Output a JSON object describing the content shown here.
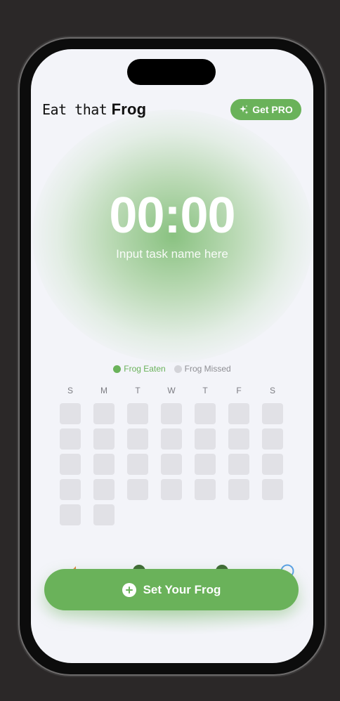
{
  "app": {
    "title_part1": "Eat that",
    "title_part2": "Frog"
  },
  "header": {
    "pro_label": "Get PRO",
    "pro_icon": "sparkles-icon"
  },
  "timer": {
    "display": "00:00",
    "task_placeholder": "Input task name here"
  },
  "legend": {
    "eaten_label": "Frog Eaten",
    "missed_label": "Frog Missed"
  },
  "calendar": {
    "day_headers": [
      "S",
      "M",
      "T",
      "W",
      "T",
      "F",
      "S"
    ],
    "cell_count": 30
  },
  "cta": {
    "label": "Set Your Frog",
    "icon": "plus-circle-icon"
  },
  "colors": {
    "accent": "#6ab25a",
    "missed": "#d4d4d9",
    "cell": "#e1e1e6",
    "background": "#f3f4f9"
  }
}
